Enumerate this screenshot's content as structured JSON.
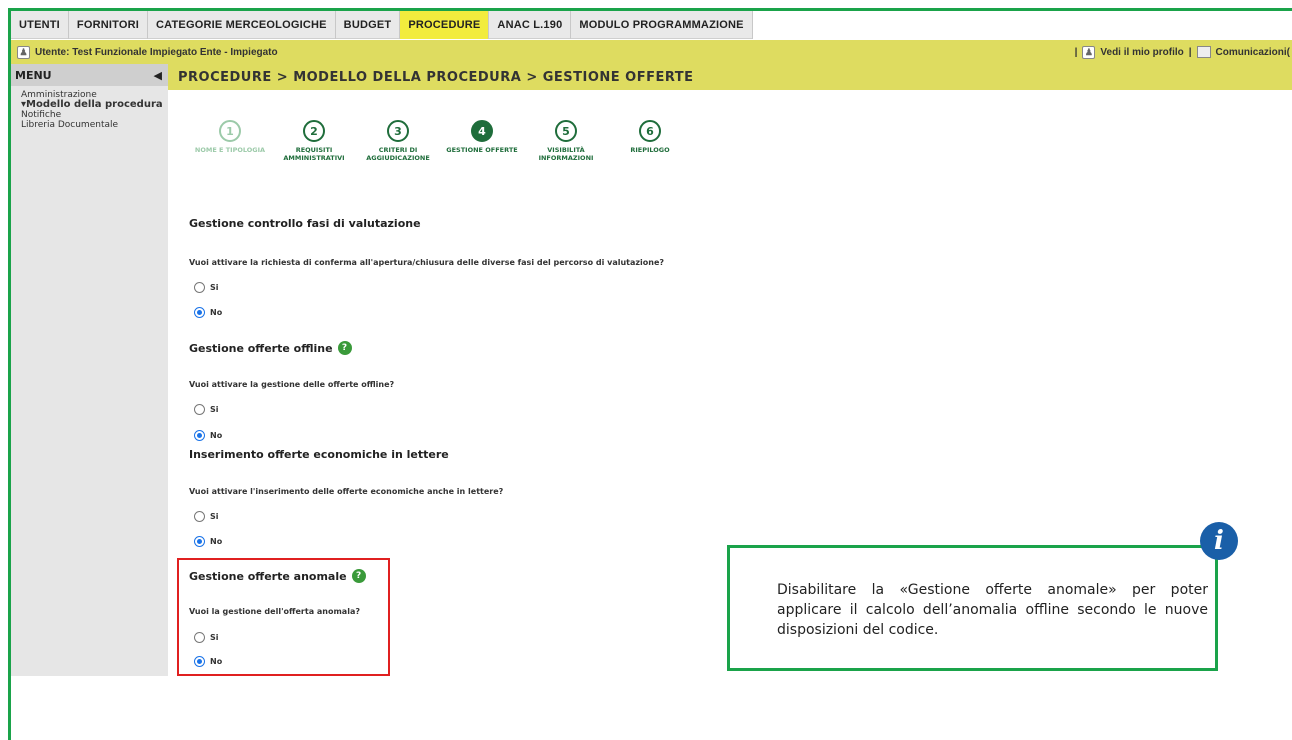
{
  "topnav": {
    "tabs": [
      "UTENTI",
      "FORNITORI",
      "CATEGORIE MERCEOLOGICHE",
      "BUDGET",
      "PROCEDURE",
      "ANAC L.190",
      "MODULO PROGRAMMAZIONE"
    ],
    "active": "PROCEDURE"
  },
  "userbar": {
    "user": "Utente: Test Funzionale Impiegato Ente - Impiegato",
    "profile_link": "Vedi il mio profilo",
    "comms_link": "Comunicazioni("
  },
  "sidebar": {
    "menu_label": "MENU",
    "items": [
      "Amministrazione",
      "▾Modello della procedura",
      "Notifiche",
      "Libreria Documentale"
    ]
  },
  "breadcrumb": "PROCEDURE  > MODELLO DELLA PROCEDURA  > GESTIONE OFFERTE",
  "steps": [
    {
      "num": "1",
      "label": "NOME E TIPOLOGIA"
    },
    {
      "num": "2",
      "label": "REQUISITI AMMINISTRATIVI"
    },
    {
      "num": "3",
      "label": "CRITERI DI AGGIUDICAZIONE"
    },
    {
      "num": "4",
      "label": "GESTIONE OFFERTE"
    },
    {
      "num": "5",
      "label": "VISIBILITÀ INFORMAZIONI"
    },
    {
      "num": "6",
      "label": "RIEPILOGO"
    }
  ],
  "sections": [
    {
      "title": "Gestione controllo fasi di valutazione",
      "question": "Vuoi attivare la richiesta di conferma all'apertura/chiusura delle diverse fasi del percorso di valutazione?",
      "yes": "Si",
      "no": "No",
      "selected": "No"
    },
    {
      "title": "Gestione offerte offline",
      "question": "Vuoi attivare la gestione delle offerte offline?",
      "yes": "Si",
      "no": "No",
      "selected": "No"
    },
    {
      "title": "Inserimento offerte economiche in lettere",
      "question": "Vuoi attivare l'inserimento delle offerte economiche anche in lettere?",
      "yes": "Si",
      "no": "No",
      "selected": "No"
    },
    {
      "title": "Gestione offerte anomale",
      "question": "Vuoi la gestione dell'offerta anomala?",
      "yes": "Si",
      "no": "No",
      "selected": "No"
    }
  ],
  "info": {
    "text": "Disabilitare la «Gestione offerte anomale» per poter applicare il calcolo dell’anomalia offline secondo le nuove disposizioni del codice.",
    "badge": "i"
  },
  "colors": {
    "frame": "#1aa34a",
    "yellow_bar": "#dedc60",
    "active_tab": "#f2ec3d",
    "step_green": "#1f6d3b",
    "highlight_red": "#e02020",
    "info_blue": "#1a5fa8"
  }
}
